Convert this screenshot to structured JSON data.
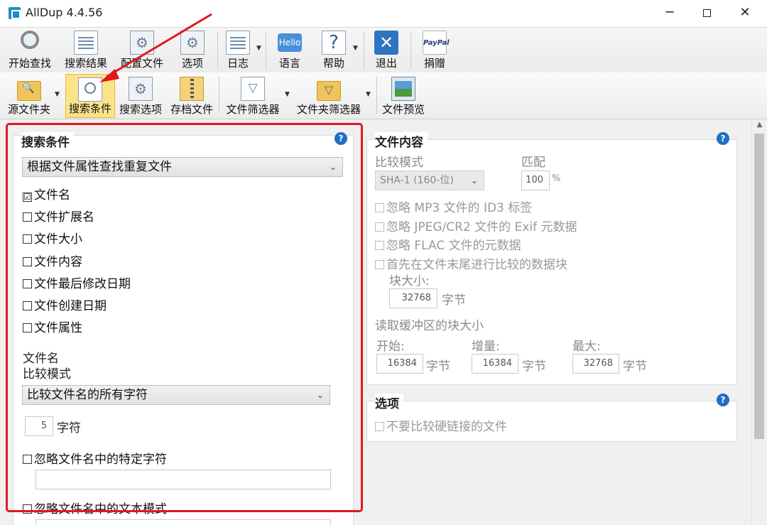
{
  "window": {
    "title": "AllDup 4.4.56",
    "min": "─",
    "max": "",
    "close": "✕"
  },
  "toolbar_top": {
    "start_search": "开始查找",
    "search_results": "搜索结果",
    "config_files": "配置文件",
    "options": "选项",
    "log": "日志",
    "language": "语言",
    "language_icon_text": "Hello",
    "help": "帮助",
    "exit": "退出",
    "donate": "捐赠",
    "paypal_icon_text": "PayPal"
  },
  "toolbar_bottom": {
    "source_folder": "源文件夹",
    "search_criteria": "搜索条件",
    "search_options": "搜索选项",
    "archive_files": "存档文件",
    "file_filter": "文件筛选器",
    "folder_filter": "文件夹筛选器",
    "file_preview": "文件预览"
  },
  "criteria": {
    "title": "搜索条件",
    "method": "根据文件属性查找重复文件",
    "checkboxes": [
      {
        "label": "文件名",
        "checked": "☑"
      },
      {
        "label": "文件扩展名",
        "checked": ""
      },
      {
        "label": "文件大小",
        "checked": ""
      },
      {
        "label": "文件内容",
        "checked": ""
      },
      {
        "label": "文件最后修改日期",
        "checked": ""
      },
      {
        "label": "文件创建日期",
        "checked": ""
      },
      {
        "label": "文件属性",
        "checked": ""
      }
    ],
    "filename_heading": "文件名",
    "compare_mode_label": "比较模式",
    "compare_mode_value": "比较文件名的所有字符",
    "chars_value": "5",
    "chars_unit": "字符",
    "ignore_specific_chars": "忽略文件名中的特定字符",
    "ignore_text_pattern": "忽略文件名中的文本模式"
  },
  "content": {
    "title": "文件内容",
    "compare_mode_label": "比较模式",
    "compare_mode_value": "SHA-1 (160-位)",
    "match_label": "匹配",
    "match_value": "100",
    "match_unit": "%",
    "ignore_mp3": "忽略 MP3 文件的 ID3 标签",
    "ignore_jpeg": "忽略 JPEG/CR2 文件的 Exif 元数据",
    "ignore_flac": "忽略 FLAC 文件的元数据",
    "compare_tail_first": "首先在文件末尾进行比较的数据块",
    "block_size_label": "块大小:",
    "block_size_value": "32768",
    "byte_unit": "字节",
    "buffer_label": "读取缓冲区的块大小",
    "start_label": "开始:",
    "start_value": "16384",
    "step_label": "增量:",
    "step_value": "16384",
    "max_label": "最大:",
    "max_value": "32768"
  },
  "options": {
    "title": "选项",
    "no_hardlinks": "不要比较硬链接的文件"
  },
  "help_glyph": "?",
  "colors": {
    "highlight_frame": "#e0191f",
    "selected_tool": "#fbe38a",
    "help_icon": "#1f6fc5"
  }
}
